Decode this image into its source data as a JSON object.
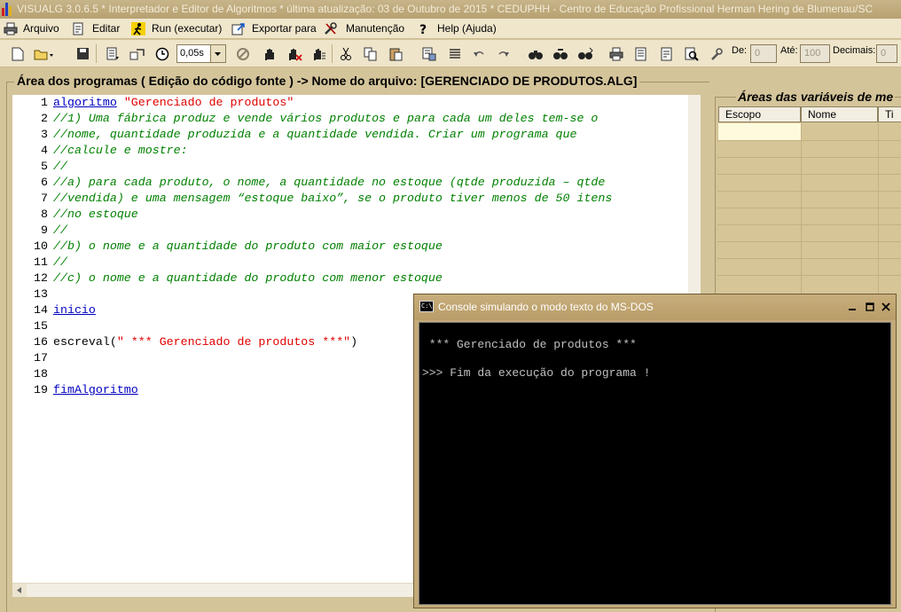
{
  "window": {
    "title": "VISUALG 3.0.6.5 * Interpretador e Editor de Algoritmos * última atualização: 03 de Outubro de 2015 * CEDUPHH - Centro de Educação Profissional Herman Hering de Blumenau/SC"
  },
  "menu": {
    "items": [
      {
        "label": "Arquivo",
        "icon": "printer-icon"
      },
      {
        "label": "Editar",
        "icon": "notepad-icon"
      },
      {
        "label": "Run (executar)",
        "icon": "runner-icon"
      },
      {
        "label": "Exportar para",
        "icon": "export-icon"
      },
      {
        "label": "Manutenção",
        "icon": "tools-icon"
      },
      {
        "label": "Help (Ajuda)",
        "icon": "help-icon"
      }
    ]
  },
  "toolbar": {
    "speed": "0,05s",
    "de_label": "De:",
    "de_value": "0",
    "ate_label": "Até:",
    "ate_value": "100",
    "decimais_label": "Decimais:",
    "decimais_value": "0"
  },
  "editor": {
    "panel_title": "Área dos programas ( Edição do código fonte ) -> Nome do arquivo: [GERENCIADO DE PRODUTOS.ALG]",
    "lines": [
      {
        "n": "1",
        "parts": [
          {
            "t": "algoritmo",
            "k": "kw"
          },
          {
            "t": " ",
            "k": "plain"
          },
          {
            "t": "\"Gerenciado de produtos\"",
            "k": "str"
          }
        ]
      },
      {
        "n": "2",
        "parts": [
          {
            "t": "//1) Uma fábrica produz e vende vários produtos e para cada um deles tem-se o",
            "k": "cm"
          }
        ]
      },
      {
        "n": "3",
        "parts": [
          {
            "t": "//nome, quantidade produzida e a quantidade vendida. Criar um programa que",
            "k": "cm"
          }
        ]
      },
      {
        "n": "4",
        "parts": [
          {
            "t": "//calcule e mostre:",
            "k": "cm"
          }
        ]
      },
      {
        "n": "5",
        "parts": [
          {
            "t": "//",
            "k": "cm"
          }
        ]
      },
      {
        "n": "6",
        "parts": [
          {
            "t": "//a) para cada produto, o nome, a quantidade no estoque (qtde produzida – qtde",
            "k": "cm"
          }
        ]
      },
      {
        "n": "7",
        "parts": [
          {
            "t": "//vendida) e uma mensagem “estoque baixo”, se o produto tiver menos de 50 itens",
            "k": "cm"
          }
        ]
      },
      {
        "n": "8",
        "parts": [
          {
            "t": "//no estoque",
            "k": "cm"
          }
        ]
      },
      {
        "n": "9",
        "parts": [
          {
            "t": "//",
            "k": "cm"
          }
        ]
      },
      {
        "n": "10",
        "parts": [
          {
            "t": "//b) o nome e a quantidade do produto com maior estoque",
            "k": "cm"
          }
        ]
      },
      {
        "n": "11",
        "parts": [
          {
            "t": "//",
            "k": "cm"
          }
        ]
      },
      {
        "n": "12",
        "parts": [
          {
            "t": "//c) o nome e a quantidade do produto com menor estoque",
            "k": "cm"
          }
        ]
      },
      {
        "n": "13",
        "parts": []
      },
      {
        "n": "14",
        "parts": [
          {
            "t": "inicio",
            "k": "kw"
          }
        ]
      },
      {
        "n": "15",
        "parts": []
      },
      {
        "n": "16",
        "parts": [
          {
            "t": "escreval(",
            "k": "plain"
          },
          {
            "t": "\" *** Gerenciado de produtos ***\"",
            "k": "str"
          },
          {
            "t": ")",
            "k": "plain"
          }
        ]
      },
      {
        "n": "17",
        "parts": []
      },
      {
        "n": "18",
        "parts": []
      },
      {
        "n": "19",
        "parts": [
          {
            "t": "fimAlgoritmo",
            "k": "kw"
          }
        ]
      }
    ]
  },
  "variables": {
    "panel_title": "Áreas das variáveis de me",
    "columns": [
      "Escopo",
      "Nome",
      "Ti"
    ]
  },
  "console": {
    "title": "Console simulando o modo texto do MS-DOS",
    "lines": [
      " *** Gerenciado de produtos ***",
      "",
      ">>> Fim da execução do programa !"
    ]
  },
  "colors": {
    "keyword": "#0000c0",
    "string": "#e00000",
    "comment": "#008000",
    "frame": "#d4c49a"
  }
}
